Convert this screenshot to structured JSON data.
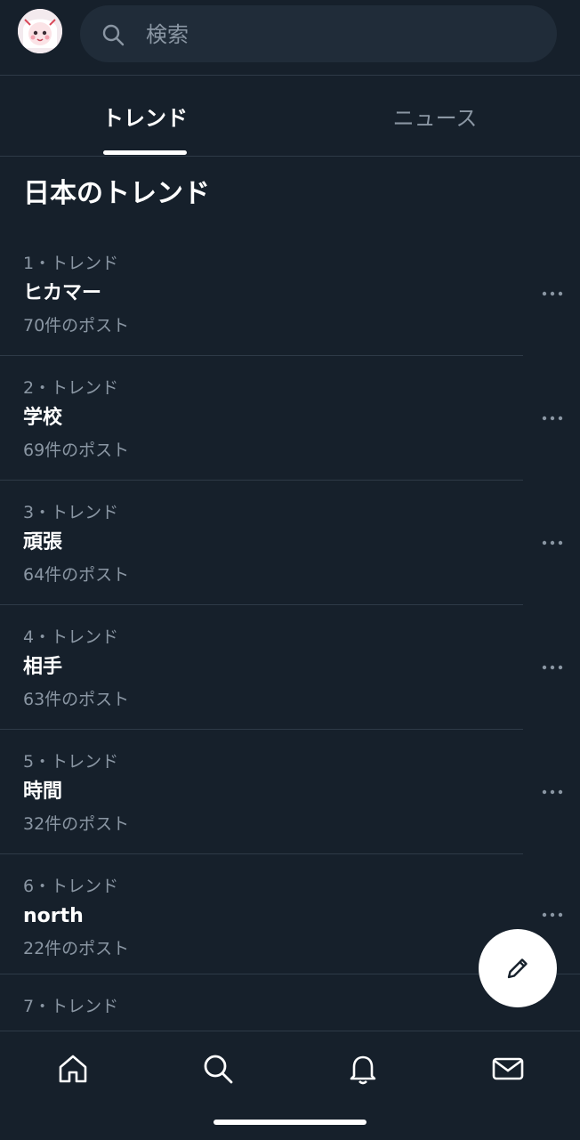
{
  "search": {
    "placeholder": "検索"
  },
  "tabs": [
    {
      "label": "トレンド",
      "active": true
    },
    {
      "label": "ニュース",
      "active": false
    }
  ],
  "section_title": "日本のトレンド",
  "trends": [
    {
      "meta": "1・トレンド",
      "name": "ヒカマー",
      "count": "70件のポスト"
    },
    {
      "meta": "2・トレンド",
      "name": "学校",
      "count": "69件のポスト"
    },
    {
      "meta": "3・トレンド",
      "name": "頑張",
      "count": "64件のポスト"
    },
    {
      "meta": "4・トレンド",
      "name": "相手",
      "count": "63件のポスト"
    },
    {
      "meta": "5・トレンド",
      "name": "時間",
      "count": "32件のポスト"
    },
    {
      "meta": "6・トレンド",
      "name": "north",
      "count": "22件のポスト"
    },
    {
      "meta": "7・トレンド",
      "name": "",
      "count": ""
    }
  ],
  "icons": {
    "search": "search-icon",
    "more": "more-horizontal-icon",
    "compose": "pencil-icon",
    "home": "home-icon",
    "explore": "search-icon",
    "notifications": "bell-icon",
    "messages": "mail-icon"
  },
  "colors": {
    "background": "#16202b",
    "search_bg": "#202c39",
    "secondary_text": "#8a96a3",
    "divider": "#2e3a47",
    "primary_text": "#ffffff"
  }
}
